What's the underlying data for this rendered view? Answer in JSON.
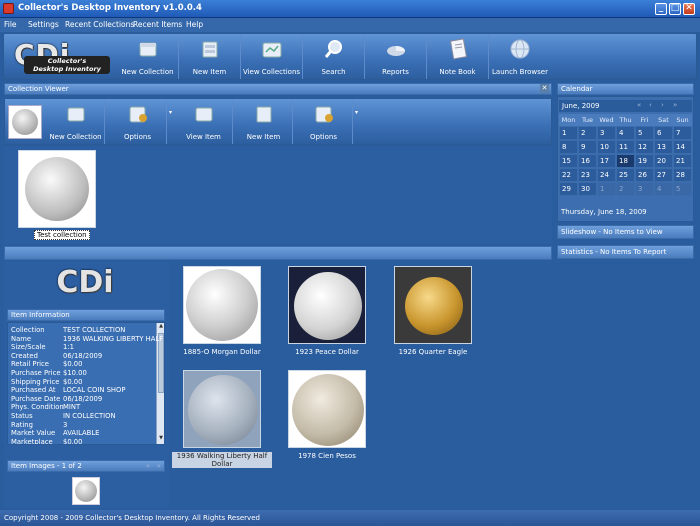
{
  "window": {
    "title": "Collector's Desktop Inventory v1.0.0.4"
  },
  "menu": [
    "File",
    "Settings",
    "Recent Collections",
    "Recent Items",
    "Help"
  ],
  "toolbar": {
    "logo": {
      "big": "CDi",
      "sub_line1": "Collector's",
      "sub_line2": "Desktop Inventory"
    },
    "buttons": [
      {
        "label": "New Collection",
        "icon": "new-collection-icon"
      },
      {
        "label": "New Item",
        "icon": "new-item-icon"
      },
      {
        "label": "View Collections",
        "icon": "view-collections-icon"
      },
      {
        "label": "Search",
        "icon": "search-icon"
      },
      {
        "label": "Reports",
        "icon": "reports-icon"
      },
      {
        "label": "Note Book",
        "icon": "notebook-icon"
      },
      {
        "label": "Launch Browser",
        "icon": "browser-globe-icon"
      }
    ]
  },
  "collection_viewer": {
    "header": "Collection Viewer",
    "buttons": [
      {
        "label": "New Collection"
      },
      {
        "label": "Options"
      },
      {
        "label": "View Item"
      },
      {
        "label": "New Item"
      },
      {
        "label": "Options"
      }
    ],
    "collections": [
      {
        "label": "Test collection"
      }
    ]
  },
  "calendar": {
    "header": "Calendar",
    "month": "June, 2009",
    "days": [
      "Mon",
      "Tue",
      "Wed",
      "Thu",
      "Fri",
      "Sat",
      "Sun"
    ],
    "weeks": [
      [
        "1",
        "2",
        "3",
        "4",
        "5",
        "6",
        "7"
      ],
      [
        "8",
        "9",
        "10",
        "11",
        "12",
        "13",
        "14"
      ],
      [
        "15",
        "16",
        "17",
        "18",
        "19",
        "20",
        "21"
      ],
      [
        "22",
        "23",
        "24",
        "25",
        "26",
        "27",
        "28"
      ],
      [
        "29",
        "30",
        "1",
        "2",
        "3",
        "4",
        "5"
      ]
    ],
    "footer": "Thursday, June 18, 2009"
  },
  "slideshow": "Slideshow - No Items to View",
  "statistics": "Statistics - No Items To Report",
  "item_info": {
    "header": "Item Information",
    "rows": [
      {
        "k": "Collection",
        "v": "TEST COLLECTION"
      },
      {
        "k": "Name",
        "v": "1936 WALKING LIBERTY HALF"
      },
      {
        "k": "Size/Scale",
        "v": "1:1"
      },
      {
        "k": "Created",
        "v": "06/18/2009"
      },
      {
        "k": "Retail Price",
        "v": "$0.00"
      },
      {
        "k": "Purchase Price",
        "v": "$10.00"
      },
      {
        "k": "Shipping Price",
        "v": "$0.00"
      },
      {
        "k": "Purchased At",
        "v": "LOCAL COIN SHOP"
      },
      {
        "k": "Purchase Date",
        "v": "06/18/2009"
      },
      {
        "k": "Phys. Condition",
        "v": "MINT"
      },
      {
        "k": "Status",
        "v": "IN COLLECTION"
      },
      {
        "k": "Rating",
        "v": "3"
      },
      {
        "k": "Market Value",
        "v": "AVAILABLE"
      },
      {
        "k": "Marketplace",
        "v": "$0.00"
      }
    ]
  },
  "item_images": {
    "header": "Item Images - 1 of 2"
  },
  "gallery": [
    {
      "label": "1885-O Morgan Dollar"
    },
    {
      "label": "1923 Peace Dollar"
    },
    {
      "label": "1926 Quarter Eagle"
    },
    {
      "label": "1936 Walking Liberty Half Dollar"
    },
    {
      "label": "1978 Cien Pesos"
    }
  ],
  "status": "Copyright 2008 - 2009 Collector's Desktop Inventory. All Rights Reserved"
}
